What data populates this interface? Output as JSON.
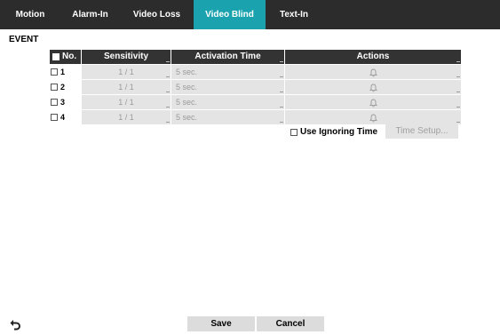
{
  "tabs": [
    {
      "label": "Motion"
    },
    {
      "label": "Alarm-In"
    },
    {
      "label": "Video Loss"
    },
    {
      "label": "Video Blind",
      "active": true
    },
    {
      "label": "Text-In"
    }
  ],
  "section": {
    "title": "EVENT"
  },
  "table": {
    "columns": {
      "no": "No.",
      "sensitivity": "Sensitivity",
      "activation": "Activation Time",
      "actions": "Actions"
    },
    "rows": [
      {
        "no": "1",
        "sensitivity": "1 / 1",
        "activation": "5 sec.",
        "actions_icon": "bell-icon",
        "checked": false
      },
      {
        "no": "2",
        "sensitivity": "1 / 1",
        "activation": "5 sec.",
        "actions_icon": "bell-icon",
        "checked": false
      },
      {
        "no": "3",
        "sensitivity": "1 / 1",
        "activation": "5 sec.",
        "actions_icon": "bell-icon",
        "checked": false
      },
      {
        "no": "4",
        "sensitivity": "1 / 1",
        "activation": "5 sec.",
        "actions_icon": "bell-icon",
        "checked": false
      }
    ]
  },
  "options": {
    "use_ignoring_time_label": "Use Ignoring Time",
    "use_ignoring_time_checked": false,
    "time_setup_label": "Time Setup..."
  },
  "footer": {
    "save_label": "Save",
    "cancel_label": "Cancel",
    "back_icon": "back-arrow-icon"
  },
  "colors": {
    "tabbar": "#2c2c2c",
    "active_tab": "#1aa3ae",
    "header_cell": "#333333",
    "cell_gray": "#e4e4e4"
  }
}
